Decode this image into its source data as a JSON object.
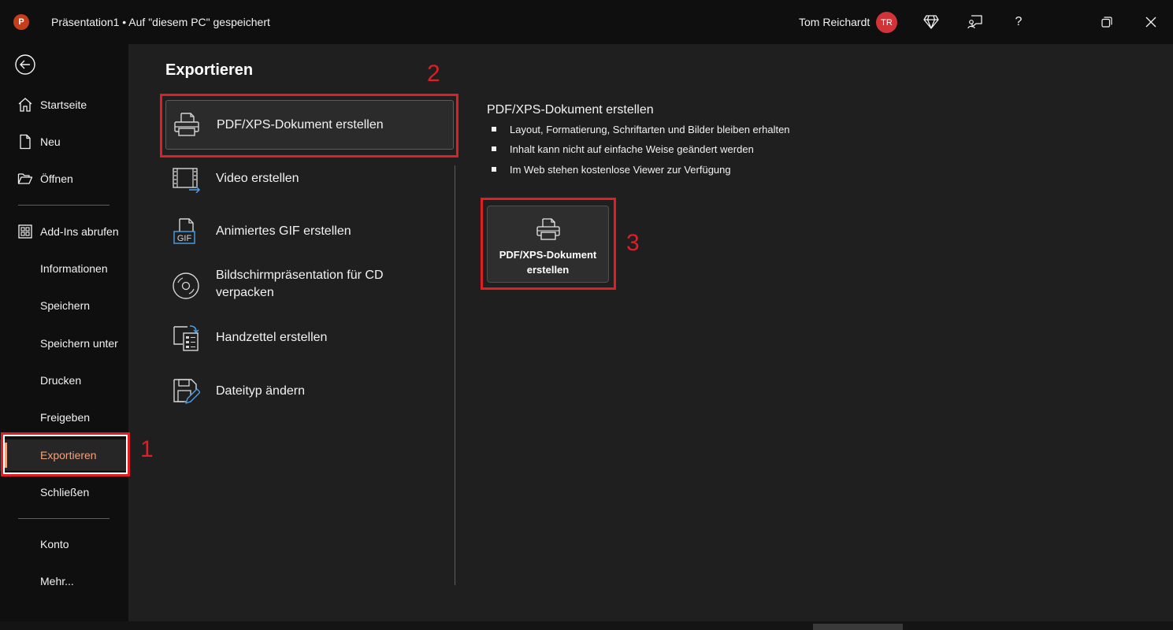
{
  "titlebar": {
    "app_logo": "P",
    "doc_title": "Präsentation1 • Auf \"diesem PC\" gespeichert",
    "user_name": "Tom Reichardt",
    "avatar_initials": "TR",
    "icons": [
      "premium-diamond-icon",
      "feedback-icon",
      "help-icon",
      "restore-window-icon",
      "close-icon"
    ],
    "help_label": "?"
  },
  "nav": {
    "back_icon": "back-arrow-icon",
    "items": [
      {
        "label": "Startseite",
        "icon": "home-icon"
      },
      {
        "label": "Neu",
        "icon": "new-document-icon"
      },
      {
        "label": "Öffnen",
        "icon": "folder-open-icon"
      },
      {
        "label": "Add-Ins abrufen",
        "icon": "add-ins-grid-icon"
      },
      {
        "label": "Informationen"
      },
      {
        "label": "Speichern"
      },
      {
        "label": "Speichern unter"
      },
      {
        "label": "Drucken"
      },
      {
        "label": "Freigeben"
      },
      {
        "label": "Exportieren",
        "active": true
      },
      {
        "label": "Schließen"
      },
      {
        "label": "Konto"
      },
      {
        "label": "Mehr..."
      }
    ]
  },
  "main": {
    "title": "Exportieren",
    "export_options": [
      {
        "label": "PDF/XPS-Dokument erstellen",
        "icon": "pdf-xps-document-icon",
        "selected": true
      },
      {
        "label": "Video erstellen",
        "icon": "video-icon"
      },
      {
        "label": "Animiertes GIF erstellen",
        "icon": "gif-icon",
        "icon_text": "GIF"
      },
      {
        "label": "Bildschirmpräsentation für CD verpacken",
        "label_lines": [
          "Bildschirmpräsentation für CD",
          "verpacken"
        ],
        "icon": "cd-package-icon"
      },
      {
        "label": "Handzettel erstellen",
        "icon": "handouts-icon"
      },
      {
        "label": "Dateityp ändern",
        "icon": "change-file-type-icon"
      }
    ],
    "detail": {
      "title": "PDF/XPS-Dokument erstellen",
      "bullets": [
        "Layout, Formatierung, Schriftarten und Bilder bleiben erhalten",
        "Inhalt kann nicht auf einfache Weise geändert werden",
        "Im Web stehen kostenlose Viewer zur Verfügung"
      ],
      "button": {
        "line1": "PDF/XPS-Dokument",
        "line2": "erstellen",
        "icon": "pdf-xps-document-icon"
      }
    }
  },
  "annotations": [
    {
      "number": "1",
      "color": "#e01e26"
    },
    {
      "number": "2",
      "color": "#e01e26"
    },
    {
      "number": "3",
      "color": "#e01e26"
    }
  ],
  "colors": {
    "accent_active": "#f4a27d",
    "annotation_red": "#e01e26",
    "avatar_red": "#d13438",
    "ppt_orange": "#c43e1c"
  }
}
